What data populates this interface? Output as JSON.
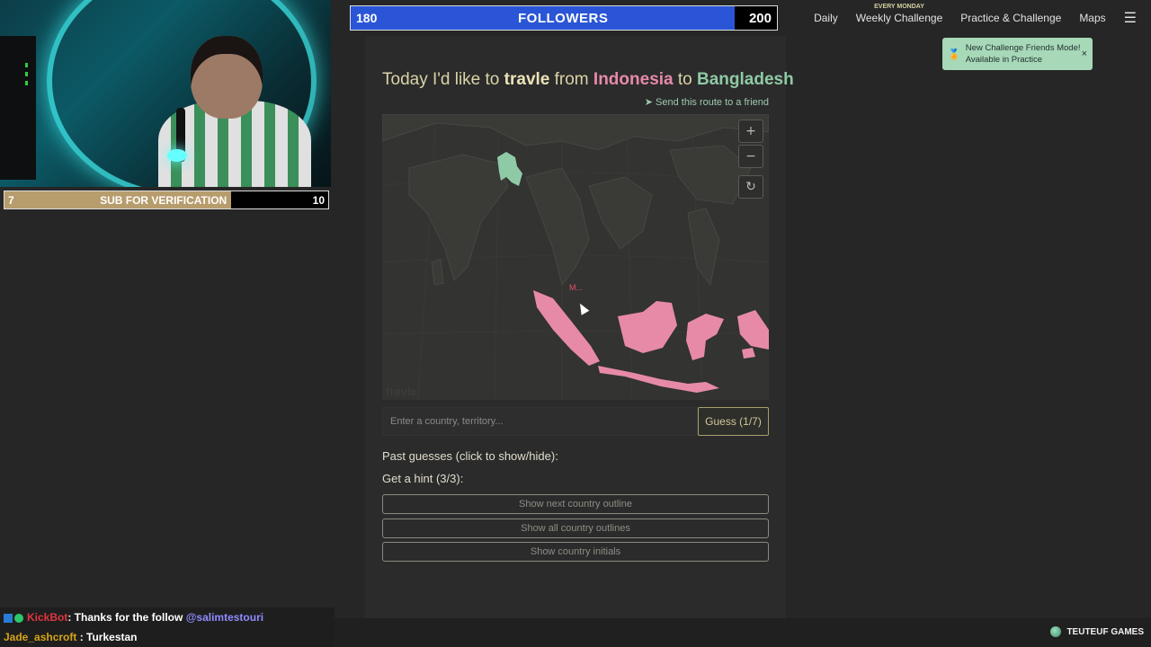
{
  "stream": {
    "sub_goal": {
      "current": "7",
      "label": "SUB FOR VERIFICATION",
      "goal": "10",
      "progress": 0.7
    },
    "followers_goal": {
      "current": "180",
      "label": "FOLLOWERS",
      "goal": "200",
      "progress": 0.9
    },
    "chat": [
      {
        "user": "KickBot",
        "text": ": Thanks for the follow ",
        "mention": "@salimtestouri"
      },
      {
        "user": "Jade_ashcroft",
        "text": " : Turkestan",
        "mention": ""
      }
    ],
    "brand": "TEUTEUF GAMES"
  },
  "nav": {
    "daily": "Daily",
    "weekly_tag": "EVERY MONDAY",
    "weekly": "Weekly Challenge",
    "practice": "Practice & Challenge",
    "maps": "Maps",
    "menu_icon": "☰"
  },
  "toast": {
    "line1": "New Challenge Friends Mode!",
    "line2": "Available in Practice",
    "close": "×"
  },
  "game": {
    "heading_pre": "Today I'd like to ",
    "heading_word": "travle",
    "heading_from": " from ",
    "from_country": "Indonesia",
    "heading_to": " to ",
    "to_country": "Bangladesh",
    "send_link": "Send this route to a friend",
    "map": {
      "zoom_in": "+",
      "zoom_out": "−",
      "reset": "↻",
      "watermark": "travle",
      "marker_label": "M...",
      "highlight_color": "#e78aa8",
      "target_color": "#8fcaa6"
    },
    "input_placeholder": "Enter a country, territory...",
    "guess_button": "Guess (1/7)",
    "past_guesses": "Past guesses (click to show/hide):",
    "hint_title": "Get a hint (3/3):",
    "hints": [
      "Show next country outline",
      "Show all country outlines",
      "Show country initials"
    ]
  }
}
